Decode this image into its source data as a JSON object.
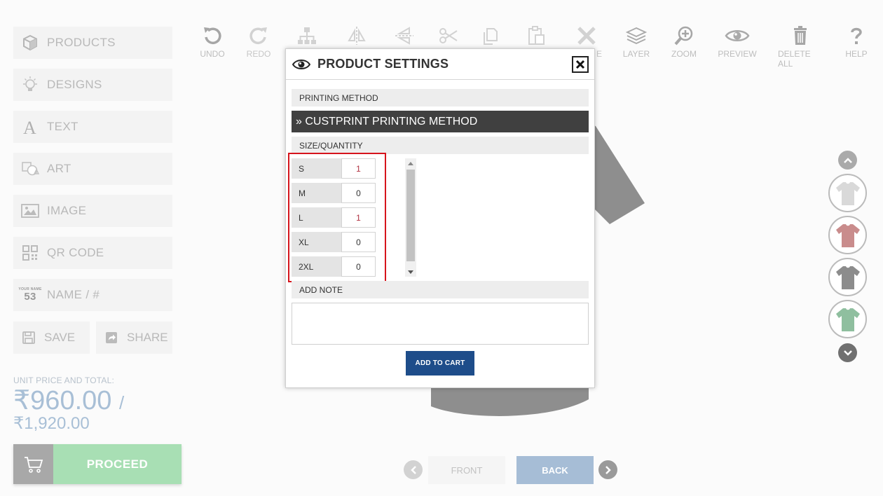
{
  "sidebar": {
    "items": [
      {
        "label": "PRODUCTS",
        "icon": "cube-icon"
      },
      {
        "label": "DESIGNS",
        "icon": "lightbulb-icon"
      },
      {
        "label": "TEXT",
        "icon": "text-icon"
      },
      {
        "label": "ART",
        "icon": "shapes-icon"
      },
      {
        "label": "IMAGE",
        "icon": "image-icon"
      },
      {
        "label": "QR CODE",
        "icon": "qr-code-icon"
      },
      {
        "label": "NAME / #",
        "icon": "name-number-icon",
        "icon_text_top": "YOUR NAME",
        "icon_text_number": "53"
      }
    ],
    "save_label": "SAVE",
    "share_label": "SHARE"
  },
  "price": {
    "label": "UNIT PRICE AND TOTAL:",
    "unit": "₹960.00",
    "slash": "/",
    "total": "₹1,920.00"
  },
  "proceed_label": "PROCEED",
  "toolbar": {
    "undo": "UNDO",
    "redo": "REDO",
    "layer": "LAYER",
    "zoom": "ZOOM",
    "preview": "PREVIEW",
    "delete_all": "DELETE ALL",
    "help": "HELP",
    "hidden_partial": "E"
  },
  "view_nav": {
    "front": "FRONT",
    "back": "BACK"
  },
  "swatch_colors": [
    "#d9d9d9",
    "#c98c8c",
    "#8c8c8c",
    "#8fbf9f"
  ],
  "modal": {
    "title": "PRODUCT SETTINGS",
    "printing_method_label": "PRINTING METHOD",
    "printing_method_value": "» CUSTPRINT PRINTING METHOD",
    "size_quantity_label": "SIZE/QUANTITY",
    "sizes": [
      {
        "size": "S",
        "qty": "1"
      },
      {
        "size": "M",
        "qty": "0"
      },
      {
        "size": "L",
        "qty": "1"
      },
      {
        "size": "XL",
        "qty": "0"
      },
      {
        "size": "2XL",
        "qty": "0"
      }
    ],
    "add_note_label": "ADD NOTE",
    "add_note_value": "",
    "add_to_cart": "ADD TO CART"
  }
}
